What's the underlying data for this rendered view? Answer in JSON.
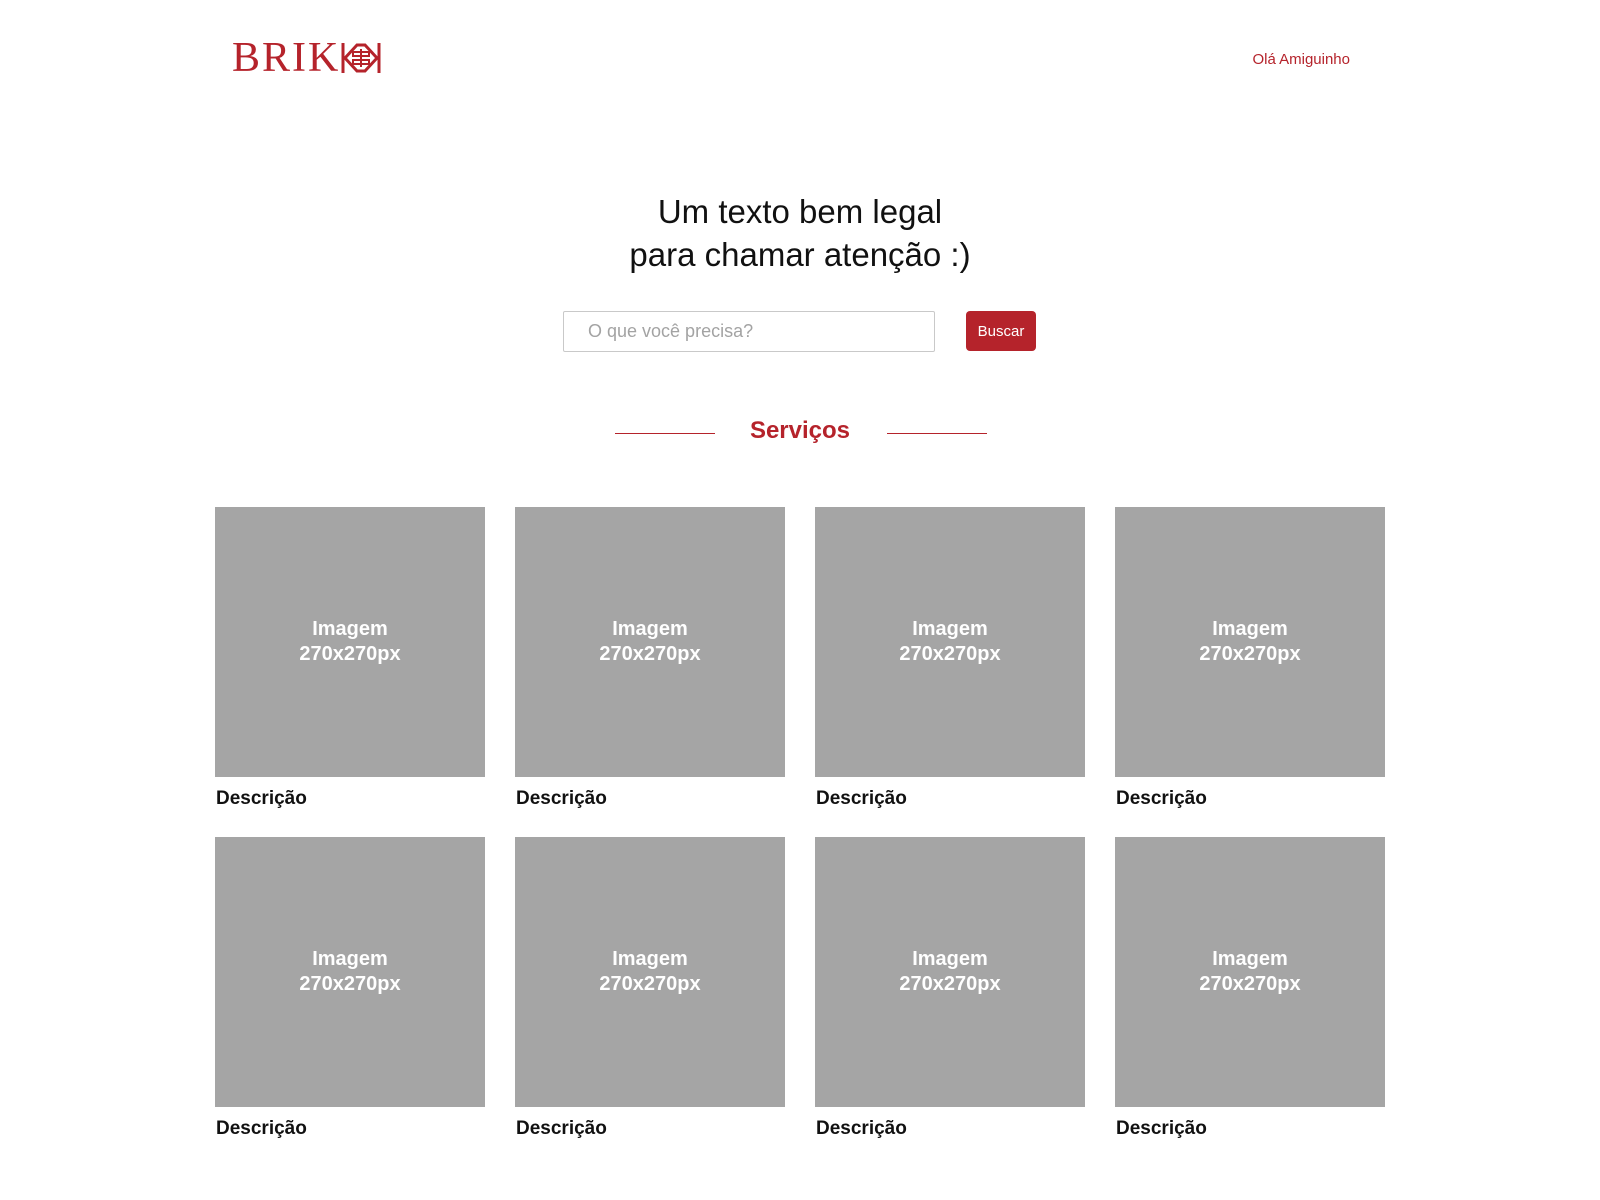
{
  "header": {
    "logo_text": "BRIK",
    "greeting": "Olá Amiguinho"
  },
  "hero": {
    "headline_line1": "Um texto bem legal",
    "headline_line2": "para chamar atenção :)"
  },
  "search": {
    "placeholder": "O que você precisa?",
    "value": "",
    "button_label": "Buscar"
  },
  "services": {
    "title": "Serviços",
    "cards": [
      {
        "image_line1": "Imagem",
        "image_line2": "270x270px",
        "description": "Descrição"
      },
      {
        "image_line1": "Imagem",
        "image_line2": "270x270px",
        "description": "Descrição"
      },
      {
        "image_line1": "Imagem",
        "image_line2": "270x270px",
        "description": "Descrição"
      },
      {
        "image_line1": "Imagem",
        "image_line2": "270x270px",
        "description": "Descrição"
      },
      {
        "image_line1": "Imagem",
        "image_line2": "270x270px",
        "description": "Descrição"
      },
      {
        "image_line1": "Imagem",
        "image_line2": "270x270px",
        "description": "Descrição"
      },
      {
        "image_line1": "Imagem",
        "image_line2": "270x270px",
        "description": "Descrição"
      },
      {
        "image_line1": "Imagem",
        "image_line2": "270x270px",
        "description": "Descrição"
      }
    ]
  },
  "colors": {
    "brand_red": "#b5232b",
    "placeholder_gray": "#a5a5a5"
  }
}
